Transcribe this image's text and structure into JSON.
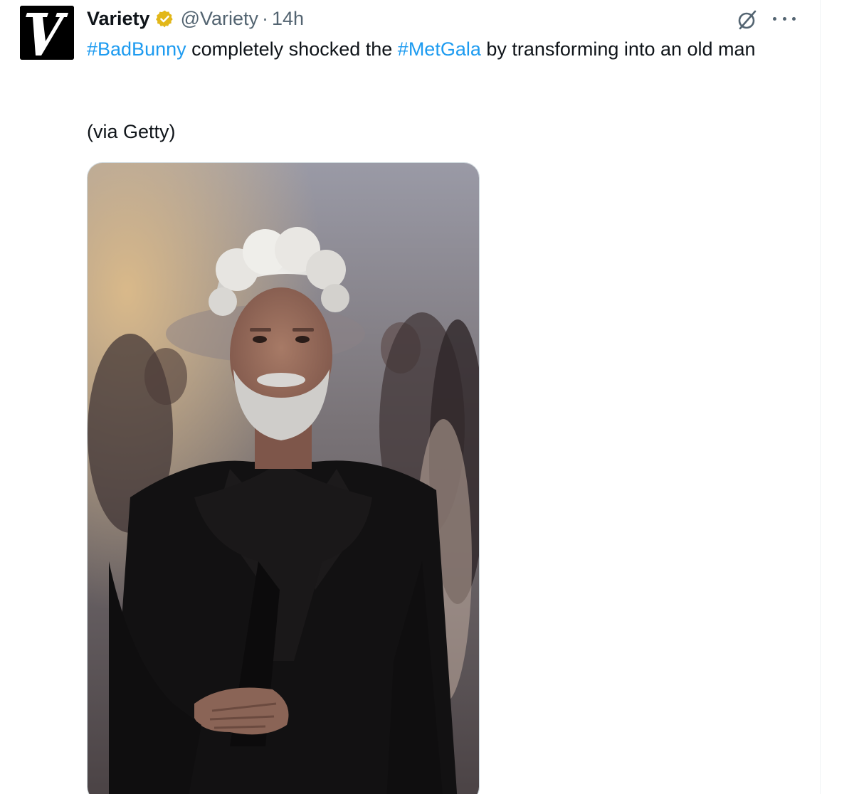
{
  "tweet": {
    "author": {
      "display_name": "Variety",
      "handle": "@Variety",
      "verified": true,
      "verified_color": "#e2b719",
      "avatar_icon": "variety-v-logo-icon",
      "avatar_letter": "V"
    },
    "separator": "·",
    "time": "14h",
    "text_parts": {
      "hashtag_1": "#BadBunny",
      "text_1": " completely shocked the ",
      "hashtag_2": "#MetGala",
      "text_2": " by transforming into an old man"
    },
    "via": "(via Getty)",
    "media_icon": "photo-man-in-black-suit-with-white-hair",
    "actions": {
      "grok_icon": "grok-slash-circle-icon",
      "more_icon": "more-ellipsis-icon"
    }
  },
  "colors": {
    "hashtag": "#1d9bf0",
    "secondary_text": "#536471",
    "primary_text": "#0f1419",
    "divider": "#eff3f4"
  }
}
